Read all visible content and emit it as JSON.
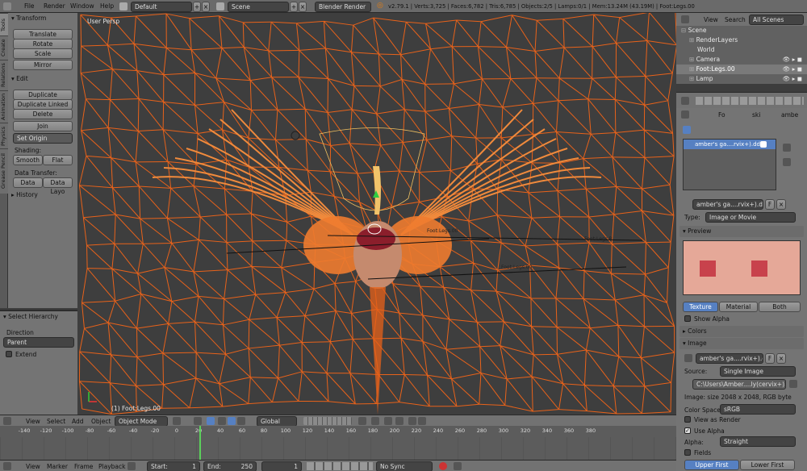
{
  "menus": [
    "File",
    "Render",
    "Window",
    "Help"
  ],
  "top": {
    "layout": "Default",
    "scene": "Scene",
    "engine": "Blender Render",
    "stats": "v2.79.1 | Verts:3,725 | Faces:6,782 | Tris:6,785 | Objects:2/5 | Lamps:0/1 | Mem:13.24M (43.19M) | Foot:Legs.00"
  },
  "tabs": [
    "Tools",
    "Create",
    "Relations",
    "Animation",
    "Physics",
    "Grease Pencil"
  ],
  "tools": {
    "transform_header": "Transform",
    "translate": "Translate",
    "rotate": "Rotate",
    "scale": "Scale",
    "mirror": "Mirror",
    "edit_header": "Edit",
    "duplicate": "Duplicate",
    "duplicate_linked": "Duplicate Linked",
    "delete": "Delete",
    "join": "Join",
    "set_origin": "Set Origin",
    "shading_label": "Shading:",
    "smooth": "Smooth",
    "flat": "Flat",
    "data_transfer_label": "Data Transfer:",
    "data": "Data",
    "data_layo": "Data Layo",
    "history_header": "History"
  },
  "hierarchy": {
    "header": "Select Hierarchy",
    "direction_label": "Direction",
    "direction_value": "Parent",
    "extend": "Extend"
  },
  "viewport": {
    "view_name": "User Persp",
    "object_label": "(1) Foot:Legs.00",
    "bone_labels": [
      "Foot:Legs.00",
      "Foot:Legs.R",
      "Foot:Legs.00"
    ]
  },
  "view3d_header": {
    "items": [
      "View",
      "Select",
      "Add",
      "Object"
    ],
    "mode": "Object Mode",
    "orientation": "Global"
  },
  "timeline": {
    "ticks": [
      "-140",
      "-120",
      "-100",
      "-80",
      "-60",
      "-40",
      "-20",
      "0",
      "20",
      "40",
      "60",
      "80",
      "100",
      "120",
      "140",
      "160",
      "180",
      "200",
      "220",
      "240",
      "260",
      "280",
      "300",
      "320",
      "340",
      "360",
      "380"
    ],
    "items": [
      "View",
      "Marker",
      "Frame",
      "Playback"
    ],
    "start_label": "Start:",
    "start": "1",
    "end_label": "End:",
    "end": "250",
    "current": "1",
    "sync": "No Sync"
  },
  "outliner": {
    "menu": [
      "View",
      "Search"
    ],
    "filter": "All Scenes",
    "rows": [
      "Scene",
      "RenderLayers",
      "World",
      "Camera",
      "Foot:Legs.00",
      "Lamp"
    ]
  },
  "properties": {
    "breadcrumb": [
      "Fo",
      "ski",
      "ambe"
    ],
    "texture_slot": "amber's ga....rvix+).dds",
    "texture_name": "amber's ga....rvix+).dds",
    "f_label": "F",
    "type_label": "Type:",
    "type_value": "Image or Movie",
    "preview_header": "Preview",
    "preview_tabs": [
      "Texture",
      "Material",
      "Both"
    ],
    "show_alpha": "Show Alpha",
    "colors_header": "Colors",
    "image_header": "Image",
    "image_name": "amber's ga....rvix+).dds",
    "source_label": "Source:",
    "source_value": "Single Image",
    "filepath": "C:\\Users\\Amber....ly(cervix+).dds",
    "image_info": "Image: size 2048 x 2048, RGB byte",
    "color_space_label": "Color Space:",
    "color_space_value": "sRGB",
    "view_as_render": "View as Render",
    "use_alpha": "Use Alpha",
    "alpha_label": "Alpha:",
    "alpha_value": "Straight",
    "fields": "Fields",
    "upper_first": "Upper First",
    "lower_first": "Lower First"
  },
  "colors": {
    "wire": "#e8621a",
    "selected": "#f0c060",
    "accent": "#5680c2",
    "background": "#3e3e3e"
  }
}
